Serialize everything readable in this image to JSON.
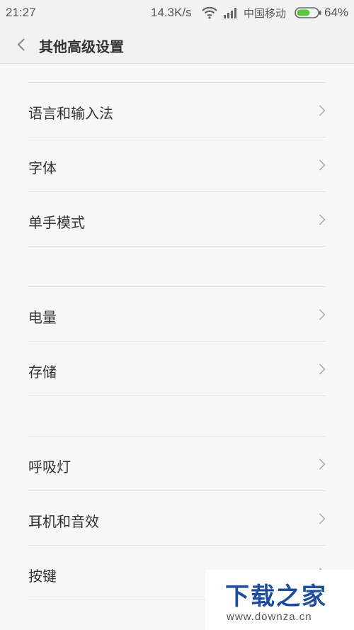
{
  "status_bar": {
    "time": "21:27",
    "net_speed": "14.3K/s",
    "carrier": "中国移动",
    "battery_percent": "64%",
    "battery_level": 0.64,
    "battery_color": "#5ac83c"
  },
  "header": {
    "title": "其他高级设置",
    "back_icon": "chevron-left-icon"
  },
  "settings": [
    {
      "label": "语言和输入法"
    },
    {
      "label": "字体"
    },
    {
      "label": "单手模式"
    },
    {
      "label": "电量"
    },
    {
      "label": "存储"
    },
    {
      "label": "呼吸灯"
    },
    {
      "label": "耳机和音效"
    },
    {
      "label": "按键"
    }
  ],
  "watermark": {
    "logo": "下载之家",
    "url": "www.downza.cn"
  }
}
